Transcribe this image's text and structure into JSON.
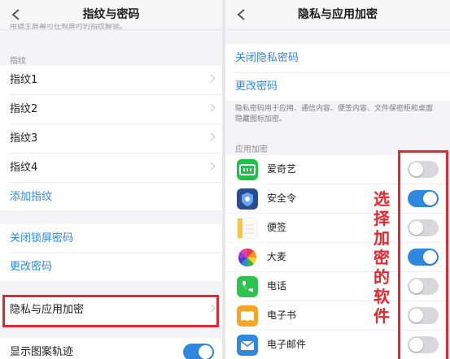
{
  "left": {
    "title": "指纹与密码",
    "cut_text": "用镜主屏幕可在规屏时的指纹解锁。",
    "fingerprint_section": "指纹",
    "fingerprints": [
      "指纹1",
      "指纹2",
      "指纹3",
      "指纹4"
    ],
    "add_fingerprint": "添加指纹",
    "close_lock_password": "关闭锁屏密码",
    "change_password": "更改密码",
    "privacy_encryption": "隐私与应用加密",
    "show_pattern_track": "显示图案轨迹",
    "show_pattern_track_on": true
  },
  "right": {
    "title": "隐私与应用加密",
    "close_privacy_password": "关闭隐私密码",
    "change_password": "更改密码",
    "description": "隐私密码用于应用、通信内容、便签内容、文件保密柜和桌面隐藏图标加密。",
    "app_section": "应用加密",
    "apps": [
      {
        "name": "爱奇艺",
        "icon": "iqiyi-icon",
        "enabled": false
      },
      {
        "name": "安全令",
        "icon": "shield-icon",
        "enabled": true
      },
      {
        "name": "便签",
        "icon": "notes-icon",
        "enabled": false
      },
      {
        "name": "大麦",
        "icon": "damai-icon",
        "enabled": true
      },
      {
        "name": "电话",
        "icon": "phone-icon",
        "enabled": false
      },
      {
        "name": "电子书",
        "icon": "ebook-icon",
        "enabled": false
      },
      {
        "name": "电子邮件",
        "icon": "email-icon",
        "enabled": false
      }
    ]
  },
  "annotation": {
    "text": "选择加密的软件",
    "color": "#e8262d"
  },
  "colors": {
    "accent": "#2f88e0",
    "highlight_red": "#e8262d"
  }
}
